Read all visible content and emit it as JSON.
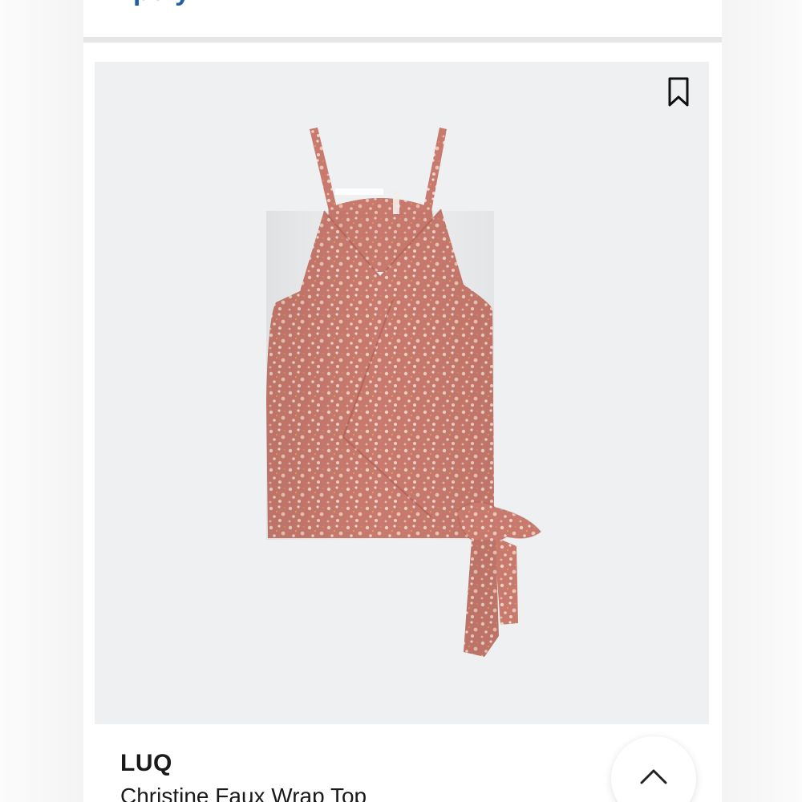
{
  "header": {
    "cut_off_text": "pe y"
  },
  "product": {
    "brand": "LUQ",
    "name": "Christine Faux Wrap Top",
    "image_subject": "pink floral print faux wrap camisole with side tie"
  },
  "icons": {
    "bookmark": "bookmark-icon",
    "scroll_up": "chevron-up-icon"
  },
  "colors": {
    "header_text": "#1f5fa8",
    "image_bg": "#eff0f2",
    "garment": "#c9766b"
  }
}
